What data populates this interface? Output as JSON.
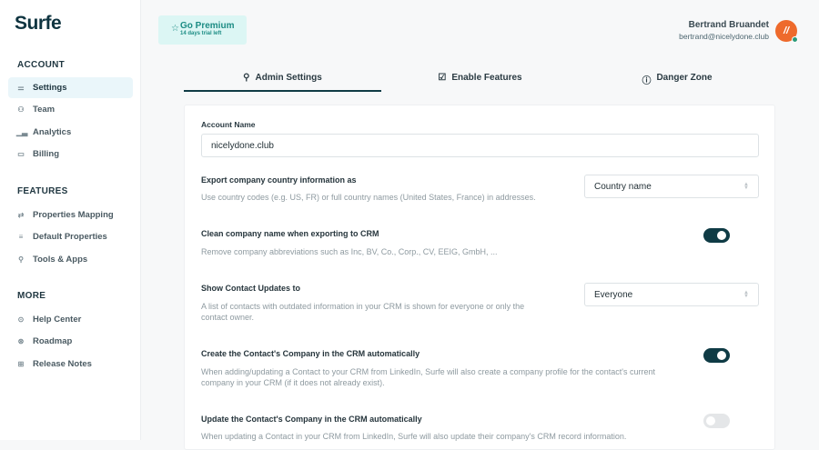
{
  "brand": "Surfe",
  "sidebar": {
    "account_header": "ACCOUNT",
    "account_items": [
      {
        "label": "Settings",
        "icon": "sliders-icon"
      },
      {
        "label": "Team",
        "icon": "users-icon"
      },
      {
        "label": "Analytics",
        "icon": "bar-chart-icon"
      },
      {
        "label": "Billing",
        "icon": "credit-card-icon"
      }
    ],
    "features_header": "FEATURES",
    "features_items": [
      {
        "label": "Properties Mapping",
        "icon": "repeat-icon"
      },
      {
        "label": "Default Properties",
        "icon": "list-icon"
      },
      {
        "label": "Tools & Apps",
        "icon": "wrench-icon"
      }
    ],
    "more_header": "MORE",
    "more_items": [
      {
        "label": "Help Center",
        "icon": "help-circle-icon"
      },
      {
        "label": "Roadmap",
        "icon": "compass-icon"
      },
      {
        "label": "Release Notes",
        "icon": "book-icon"
      }
    ]
  },
  "premium": {
    "title": "Go Premium",
    "subtitle": "14 days trial left"
  },
  "user": {
    "name": "Bertrand Bruandet",
    "email": "bertrand@nicelydone.club"
  },
  "tabs": [
    {
      "label": "Admin Settings",
      "icon": "user-icon"
    },
    {
      "label": "Enable Features",
      "icon": "check-square-icon"
    },
    {
      "label": "Danger Zone",
      "icon": "alert-circle-icon"
    }
  ],
  "form": {
    "account_name_label": "Account Name",
    "account_name_value": "nicelydone.club",
    "settings": [
      {
        "title": "Export company country information as",
        "desc": "Use country codes (e.g. US, FR) or full country names (United States, France) in addresses.",
        "select": "Country name"
      },
      {
        "title": "Clean company name when exporting to CRM",
        "desc": "Remove company abbreviations such as Inc, BV, Co., Corp., CV, EEIG, GmbH, ...",
        "toggle": true
      },
      {
        "title": "Show Contact Updates to",
        "desc": "A list of contacts with outdated information in your CRM is shown for everyone or only the contact owner.",
        "select": "Everyone"
      },
      {
        "title": "Create the Contact's Company in the CRM automatically",
        "desc": "When adding/updating a Contact to your CRM from LinkedIn, Surfe will also create a company profile for the contact's current company in your CRM (if it does not already exist).",
        "toggle": true
      },
      {
        "title": "Update the Contact's Company in the CRM automatically",
        "desc": "When updating a Contact in your CRM from LinkedIn, Surfe will also update their company's CRM record information.",
        "toggle": false
      }
    ]
  },
  "colors": {
    "accent": "#0f3b45",
    "premium_bg": "#dcf6f4",
    "premium_text": "#1c8c84",
    "avatar": "#ee6a2c"
  }
}
